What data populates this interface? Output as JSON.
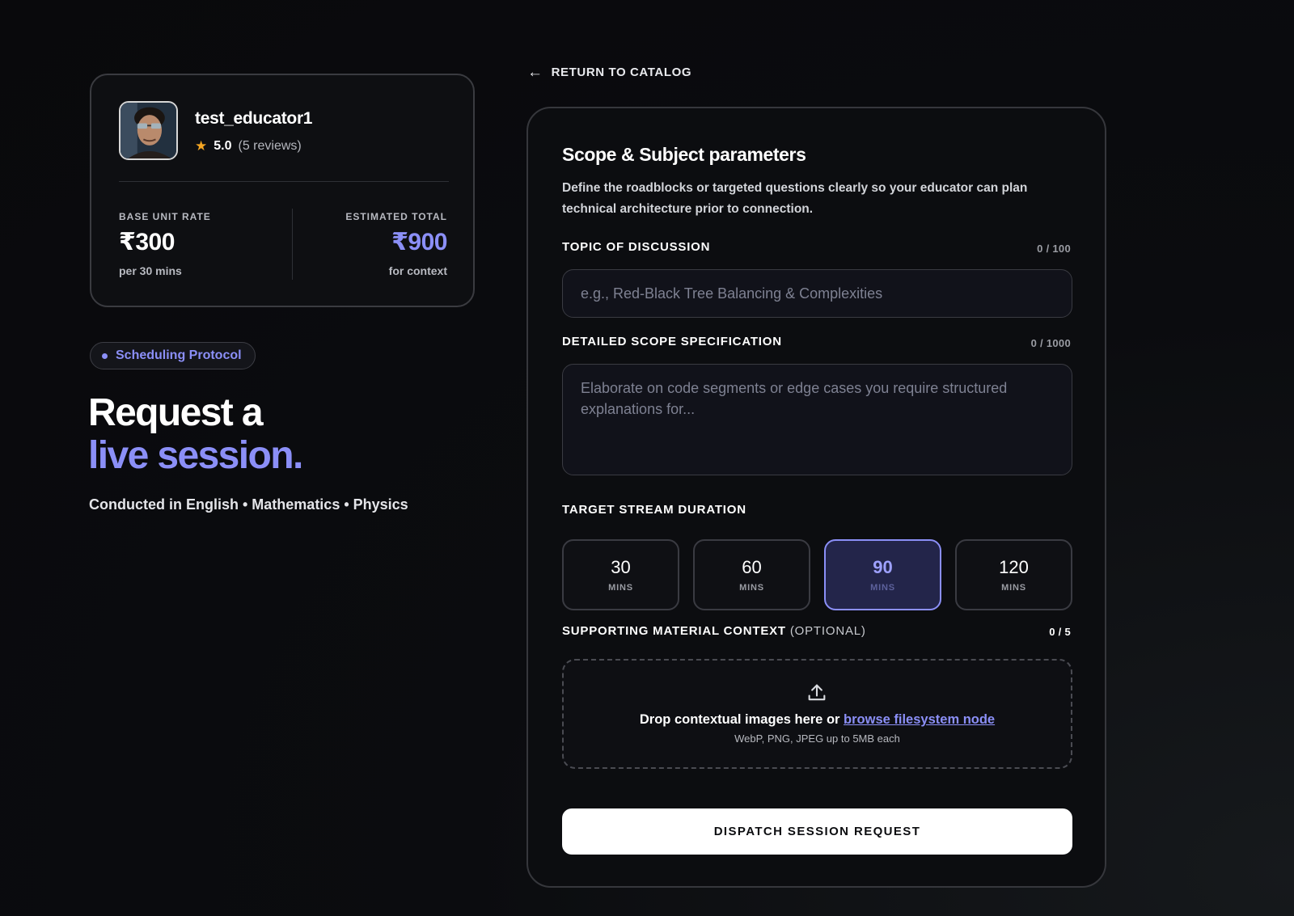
{
  "educator": {
    "name": "test_educator1",
    "rating": "5.0",
    "reviews": "(5 reviews)",
    "base_label": "BASE UNIT RATE",
    "base_value": "₹300",
    "base_sub": "per 30 mins",
    "total_label": "ESTIMATED TOTAL",
    "total_value": "₹900",
    "total_sub": "for context"
  },
  "hero": {
    "pill": "Scheduling Protocol",
    "title_line1": "Request a",
    "title_line2": "live session.",
    "subjects": "Conducted in English • Mathematics • Physics"
  },
  "nav": {
    "return_label": "RETURN TO CATALOG"
  },
  "form": {
    "title": "Scope & Subject parameters",
    "description": "Define the roadblocks or targeted questions clearly so your educator can plan technical architecture prior to connection.",
    "topic_label": "TOPIC OF DISCUSSION",
    "topic_counter": "0 / 100",
    "topic_placeholder": "e.g., Red-Black Tree Balancing & Complexities",
    "scope_label": "DETAILED SCOPE SPECIFICATION",
    "scope_counter": "0 / 1000",
    "scope_placeholder": "Elaborate on code segments or edge cases you require structured explanations for...",
    "duration_label": "TARGET STREAM DURATION",
    "durations": [
      {
        "value": "30",
        "unit": "MINS"
      },
      {
        "value": "60",
        "unit": "MINS"
      },
      {
        "value": "90",
        "unit": "MINS"
      },
      {
        "value": "120",
        "unit": "MINS"
      }
    ],
    "selected_duration": "90",
    "material_label": "SUPPORTING MATERIAL CONTEXT",
    "material_optional": "(OPTIONAL)",
    "material_counter": "0 / 5",
    "drop_text": "Drop contextual images here or",
    "drop_link": "browse filesystem node",
    "drop_hint": "WebP, PNG, JPEG up to 5MB each",
    "submit_label": "DISPATCH SESSION REQUEST"
  },
  "colors": {
    "accent": "#8b8ff7",
    "star": "#f5a623",
    "background": "#0a0b0e"
  },
  "icons": {
    "back": "arrow-left-icon",
    "star": "star-icon",
    "upload": "upload-icon"
  }
}
